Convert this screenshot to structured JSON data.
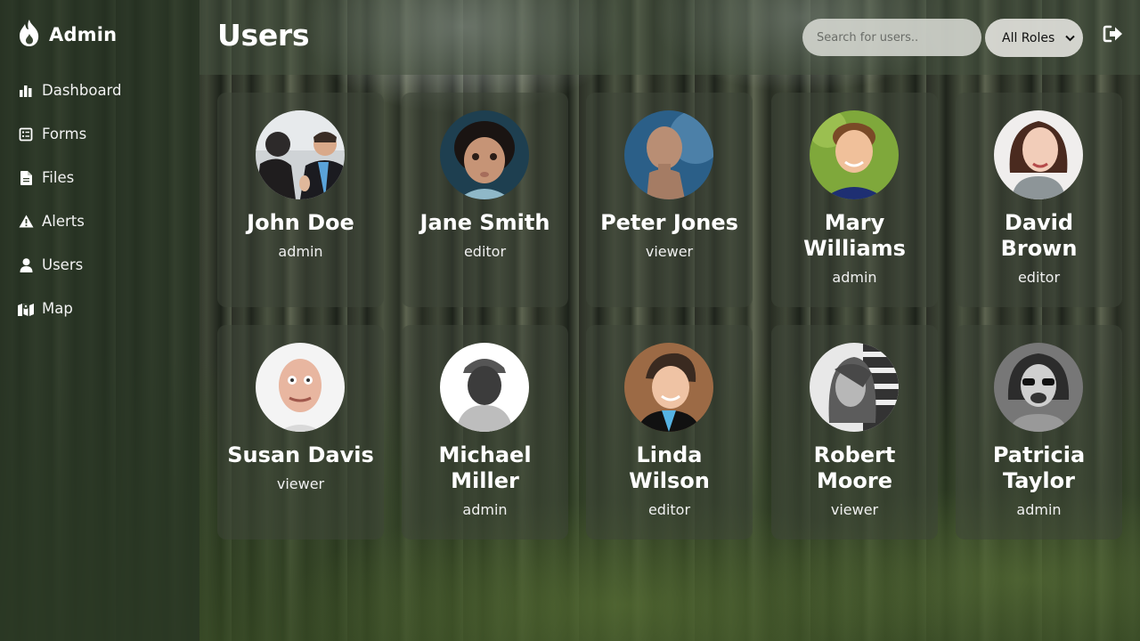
{
  "brand": {
    "name": "Admin",
    "icon": "flame-icon"
  },
  "nav": {
    "items": [
      {
        "label": "Dashboard",
        "icon": "bar-chart-icon"
      },
      {
        "label": "Forms",
        "icon": "form-icon"
      },
      {
        "label": "Files",
        "icon": "file-icon"
      },
      {
        "label": "Alerts",
        "icon": "alert-icon"
      },
      {
        "label": "Users",
        "icon": "user-icon"
      },
      {
        "label": "Map",
        "icon": "map-icon"
      }
    ]
  },
  "header": {
    "title": "Users",
    "search_placeholder": "Search for users..",
    "role_filter": "All Roles",
    "logout_icon": "logout-icon"
  },
  "users": [
    {
      "name": "John Doe",
      "role": "admin"
    },
    {
      "name": "Jane Smith",
      "role": "editor"
    },
    {
      "name": "Peter Jones",
      "role": "viewer"
    },
    {
      "name": "Mary Williams",
      "role": "admin"
    },
    {
      "name": "David Brown",
      "role": "editor"
    },
    {
      "name": "Susan Davis",
      "role": "viewer"
    },
    {
      "name": "Michael Miller",
      "role": "admin"
    },
    {
      "name": "Linda Wilson",
      "role": "editor"
    },
    {
      "name": "Robert Moore",
      "role": "viewer"
    },
    {
      "name": "Patricia Taylor",
      "role": "admin"
    }
  ]
}
